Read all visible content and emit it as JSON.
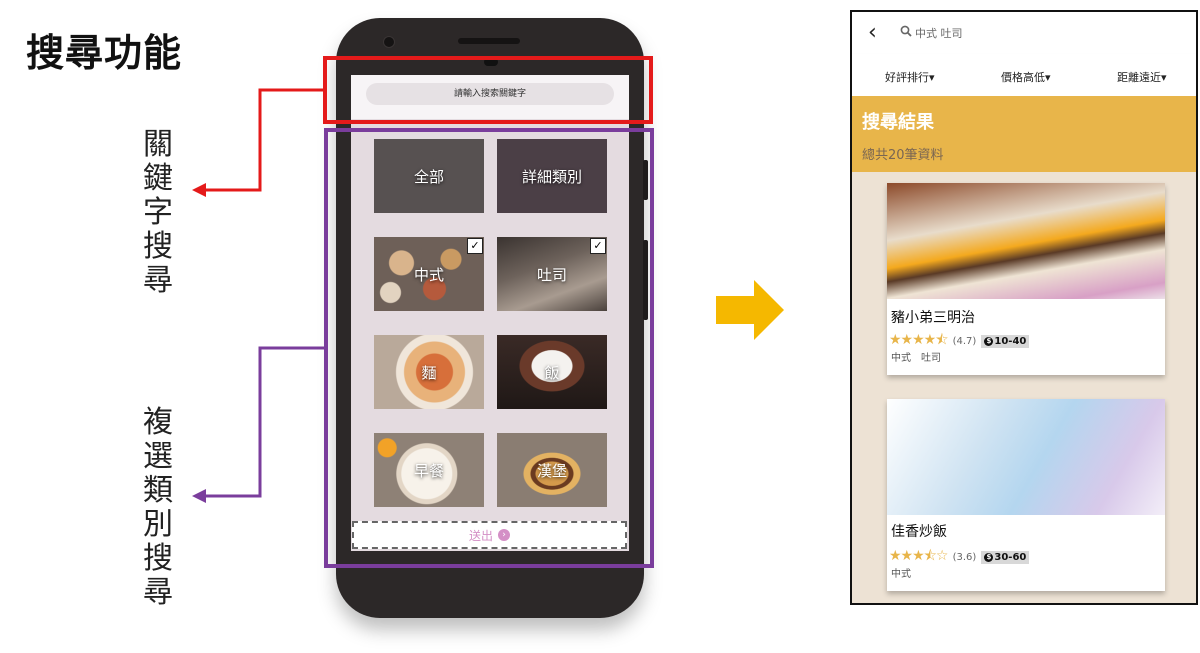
{
  "title": "搜尋功能",
  "annotations": {
    "keyword_search": "關鍵字搜尋",
    "multi_category_search": "複選類別搜尋"
  },
  "colors": {
    "keyword_frame": "#e41a1a",
    "category_frame": "#7a3d9c",
    "transition_arrow": "#f5b800",
    "result_band": "#e8b54a",
    "submit_accent": "#d48fc6"
  },
  "phone": {
    "search_placeholder": "請輸入搜索關鍵字",
    "categories": [
      {
        "label": "全部",
        "checked": false
      },
      {
        "label": "詳細類別",
        "checked": false
      },
      {
        "label": "中式",
        "checked": true
      },
      {
        "label": "吐司",
        "checked": true
      },
      {
        "label": "麵",
        "checked": false
      },
      {
        "label": "飯",
        "checked": false
      },
      {
        "label": "早餐",
        "checked": false
      },
      {
        "label": "漢堡",
        "checked": false
      }
    ],
    "submit_label": "送出",
    "submit_icon": "chevron-right-circle-icon"
  },
  "result_screen": {
    "back_icon": "back-arrow-icon",
    "search_icon": "search-icon",
    "search_query": "中式 吐司",
    "sort_options": [
      "好評排行▾",
      "價格高低▾",
      "距離遠近▾"
    ],
    "header_title": "搜尋結果",
    "result_count_text": "總共20筆資料",
    "results": [
      {
        "name": "豬小弟三明治",
        "rating": 4.7,
        "rating_text": "(4.7)",
        "price": "10-40",
        "tags": "中式　吐司"
      },
      {
        "name": "佳香炒飯",
        "rating": 3.6,
        "rating_text": "(3.6)",
        "price": "30-60",
        "tags": "中式"
      }
    ]
  }
}
